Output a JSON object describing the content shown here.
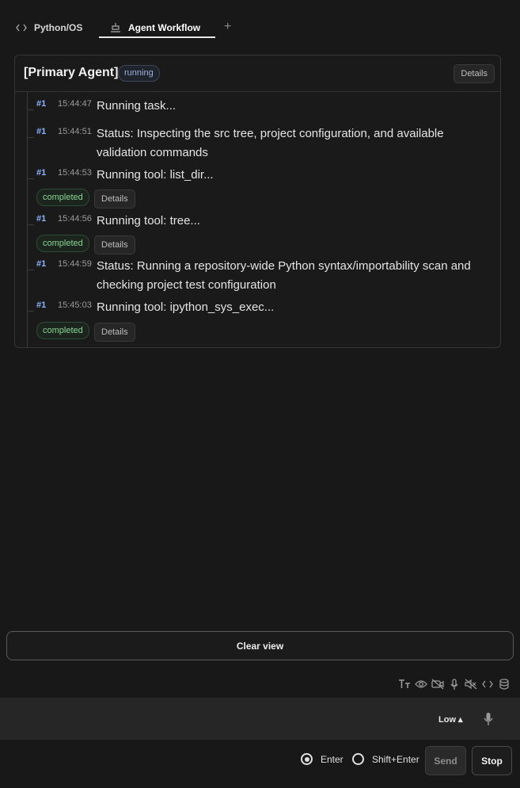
{
  "tabs": [
    {
      "label": "Python/OS",
      "icon": "code-icon"
    },
    {
      "label": "Agent Workflow",
      "icon": "workflow-icon",
      "active": true
    }
  ],
  "agent": {
    "title": "[Primary Agent]",
    "status": "running",
    "details_label": "Details"
  },
  "entries": [
    {
      "id": "#1",
      "time": "15:44:47",
      "text": "Running task..."
    },
    {
      "id": "#1",
      "time": "15:44:51",
      "text": "Status: Inspecting the src tree, project configuration, and available validation commands"
    },
    {
      "id": "#1",
      "time": "15:44:53",
      "text": "Running tool: list_dir...",
      "status": "completed",
      "details_label": "Details"
    },
    {
      "id": "#1",
      "time": "15:44:56",
      "text": "Running tool: tree...",
      "status": "completed",
      "details_label": "Details"
    },
    {
      "id": "#1",
      "time": "15:44:59",
      "text": "Status: Running a repository-wide Python syntax/importability scan and checking project test configuration"
    },
    {
      "id": "#1",
      "time": "15:45:03",
      "text": "Running tool: ipython_sys_exec...",
      "status": "completed",
      "details_label": "Details"
    }
  ],
  "clear_view_label": "Clear view",
  "toolbar_icons": [
    "text-size-icon",
    "eye-icon",
    "video-off-icon",
    "mic-icon",
    "speaker-off-icon",
    "code-icon",
    "database-icon"
  ],
  "input": {
    "value": "",
    "placeholder": ""
  },
  "level": "Low ▴",
  "send_mode": {
    "enter": "Enter",
    "shift_enter": "Shift+Enter",
    "selected": "Enter"
  },
  "send_label": "Send",
  "stop_label": "Stop",
  "colors": {
    "background": "#181818",
    "accent_id": "#8fb3ff",
    "completed": "#8ad694",
    "running": "#9fb2da"
  }
}
